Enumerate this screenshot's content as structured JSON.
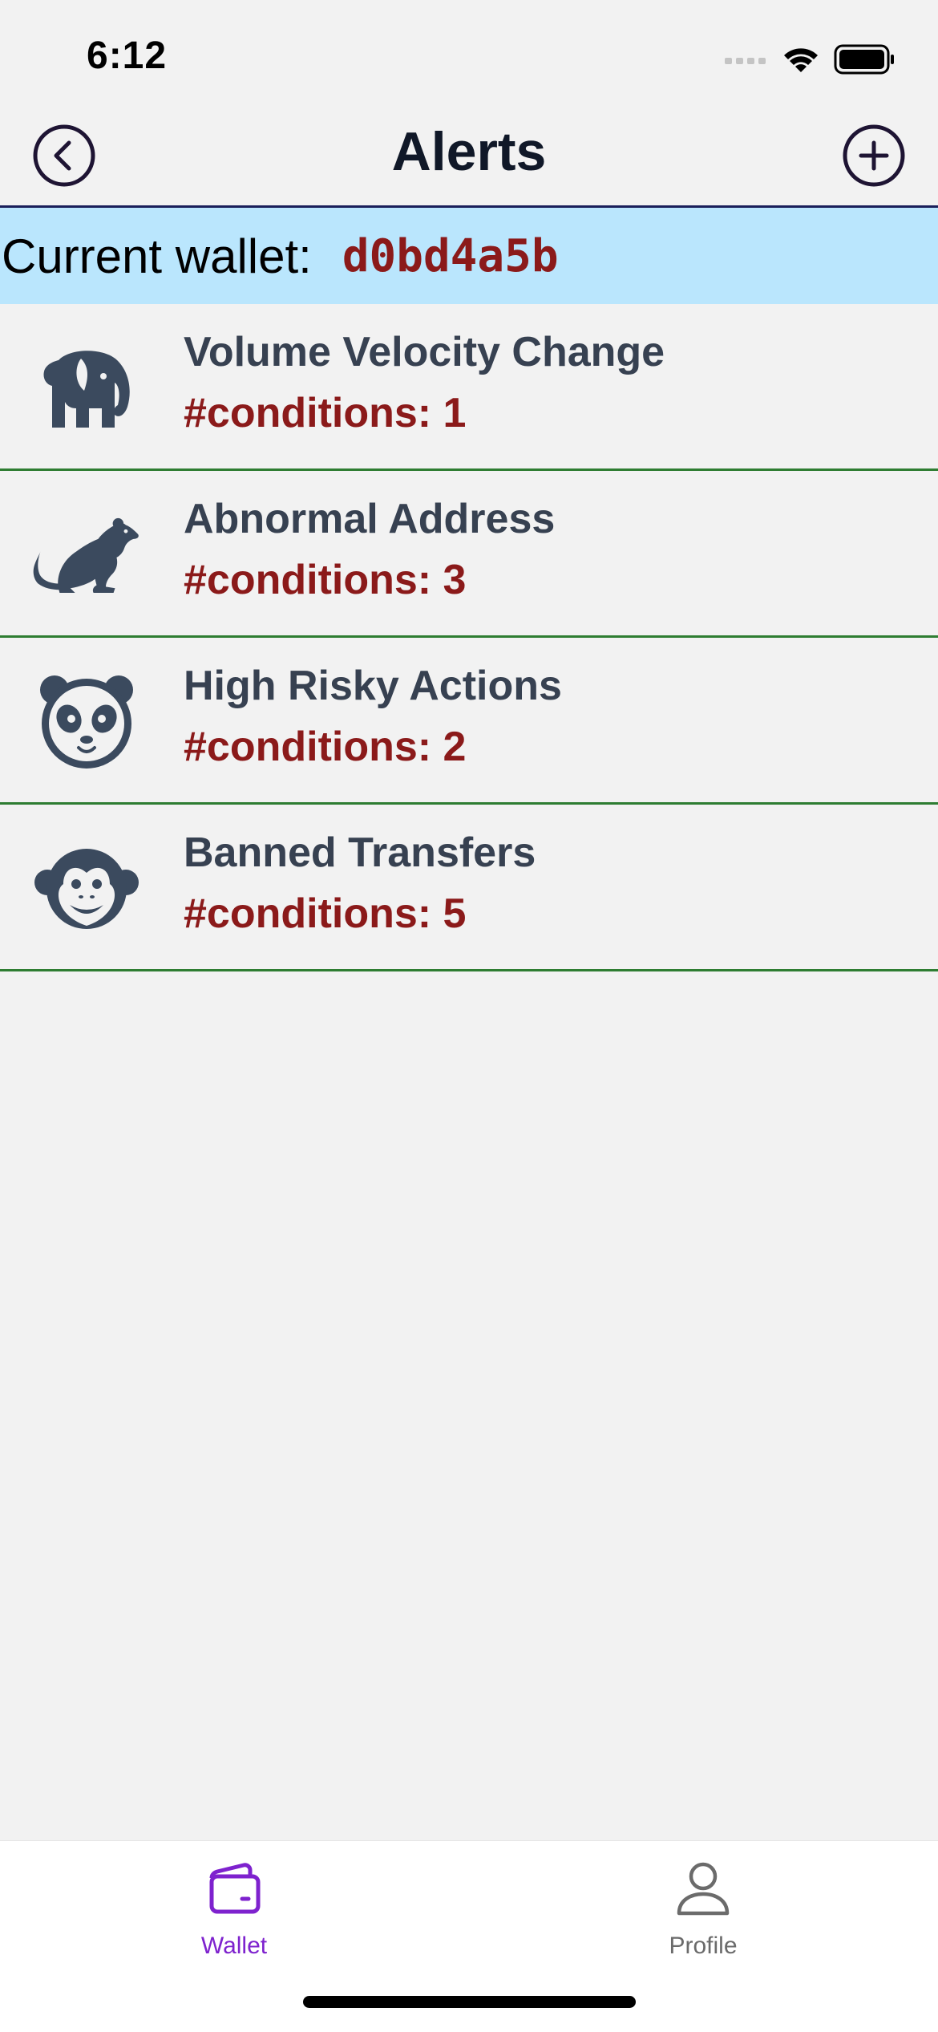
{
  "status_bar": {
    "time": "6:12"
  },
  "header": {
    "title": "Alerts",
    "back_icon": "chevron-left-circle-icon",
    "add_icon": "plus-circle-icon"
  },
  "wallet": {
    "label": "Current wallet:",
    "value": "d0bd4a5b"
  },
  "alerts": [
    {
      "icon": "elephant-icon",
      "name": "Volume Velocity Change",
      "conditions": "#conditions: 1"
    },
    {
      "icon": "rat-icon",
      "name": "Abnormal Address",
      "conditions": "#conditions: 3"
    },
    {
      "icon": "panda-icon",
      "name": "High Risky Actions",
      "conditions": "#conditions: 2"
    },
    {
      "icon": "monkey-icon",
      "name": "Banned Transfers",
      "conditions": "#conditions: 5"
    }
  ],
  "tab_bar": {
    "tabs": [
      {
        "label": "Wallet",
        "icon": "wallet-icon",
        "active": true
      },
      {
        "label": "Profile",
        "icon": "person-icon",
        "active": false
      }
    ]
  },
  "colors": {
    "background": "#f2f2f2",
    "banner": "#bae6fd",
    "wallet_value": "#8b1a1a",
    "conditions": "#8b1a1a",
    "divider": "#2e7d32",
    "active_tab": "#7e22ce",
    "icon": "#3b4a5e"
  }
}
